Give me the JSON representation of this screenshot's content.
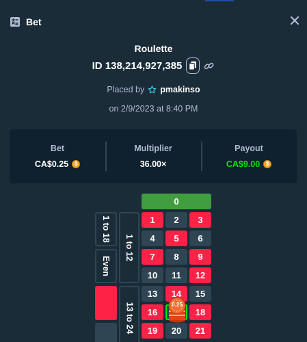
{
  "header": {
    "title": "Bet",
    "icon": "bet-slip-icon",
    "close_icon": "close-icon"
  },
  "bet": {
    "game": "Roulette",
    "id": "ID 138,214,927,385",
    "placed_by_label": "Placed by",
    "username": "pmakinso",
    "date": "on 2/9/2023 at 8:40 PM"
  },
  "stats": {
    "bet_label": "Bet",
    "bet_value": "CA$0.25",
    "multiplier_label": "Multiplier",
    "multiplier_value": "36.00×",
    "payout_label": "Payout",
    "payout_value": "CA$9.00"
  },
  "colors": {
    "red": "#fe2247",
    "black": "#2f4553",
    "green": "#419e3f",
    "payout": "#00e701",
    "background": "#1a2c38",
    "panel": "#0f212e"
  },
  "table": {
    "zero": "0",
    "numbers": [
      {
        "n": "1",
        "color": "red"
      },
      {
        "n": "2",
        "color": "black"
      },
      {
        "n": "3",
        "color": "red"
      },
      {
        "n": "4",
        "color": "black"
      },
      {
        "n": "5",
        "color": "red"
      },
      {
        "n": "6",
        "color": "black"
      },
      {
        "n": "7",
        "color": "red"
      },
      {
        "n": "8",
        "color": "black"
      },
      {
        "n": "9",
        "color": "red"
      },
      {
        "n": "10",
        "color": "black"
      },
      {
        "n": "11",
        "color": "black"
      },
      {
        "n": "12",
        "color": "red"
      },
      {
        "n": "13",
        "color": "black"
      },
      {
        "n": "14",
        "color": "red"
      },
      {
        "n": "15",
        "color": "black"
      },
      {
        "n": "16",
        "color": "red"
      },
      {
        "n": "17",
        "color": "black"
      },
      {
        "n": "18",
        "color": "red"
      },
      {
        "n": "19",
        "color": "red"
      },
      {
        "n": "20",
        "color": "black"
      },
      {
        "n": "21",
        "color": "red"
      }
    ],
    "dozens": [
      "1 to 12",
      "13 to 24"
    ],
    "outside": [
      "1 to 18",
      "Even"
    ],
    "chip_value": "0.25",
    "chip_on": "17"
  }
}
